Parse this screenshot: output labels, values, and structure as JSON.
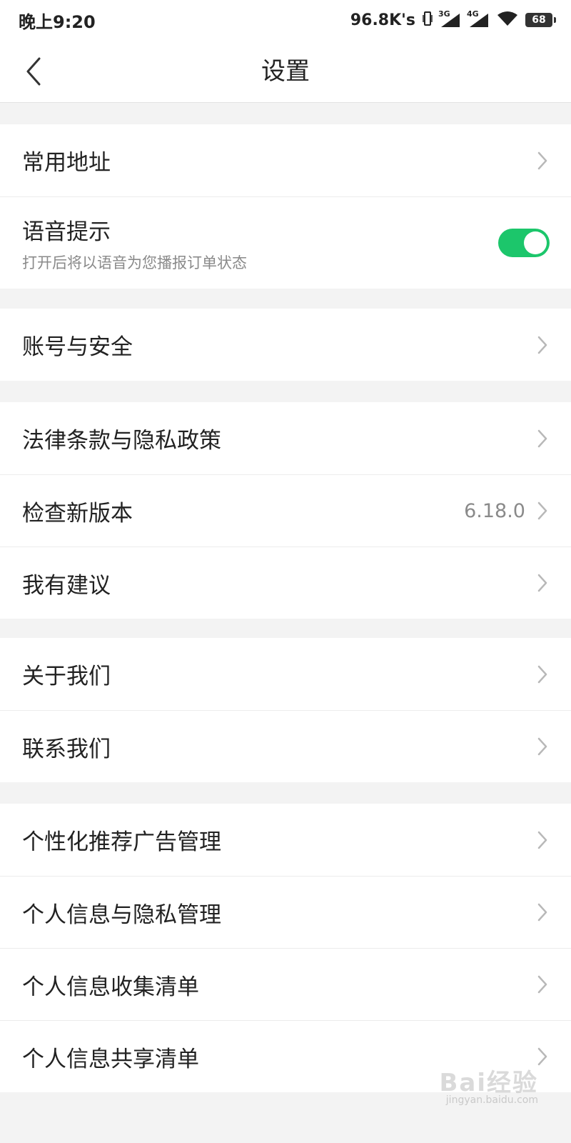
{
  "status_bar": {
    "time": "晚上9:20",
    "speed": "96.8K's",
    "net1": "3G",
    "net2": "4G",
    "battery": "68"
  },
  "nav": {
    "back_icon": "chevron-left-icon",
    "title": "设置"
  },
  "groups": [
    {
      "rows": [
        {
          "label": "常用地址"
        },
        {
          "label": "语音提示",
          "sub": "打开后将以语音为您播报订单状态",
          "toggle": true
        }
      ]
    },
    {
      "rows": [
        {
          "label": "账号与安全"
        }
      ]
    },
    {
      "rows": [
        {
          "label": "法律条款与隐私政策"
        },
        {
          "label": "检查新版本",
          "value": "6.18.0"
        },
        {
          "label": "我有建议"
        }
      ]
    },
    {
      "rows": [
        {
          "label": "关于我们"
        },
        {
          "label": "联系我们"
        }
      ]
    },
    {
      "rows": [
        {
          "label": "个性化推荐广告管理"
        },
        {
          "label": "个人信息与隐私管理"
        },
        {
          "label": "个人信息收集清单"
        },
        {
          "label": "个人信息共享清单"
        }
      ]
    }
  ],
  "watermark": {
    "brand": "Bai经验",
    "url": "jingyan.baidu.com"
  },
  "colors": {
    "accent_toggle": "#1cc66b",
    "background": "#f3f3f3",
    "secondary_text": "#8a8a8a"
  }
}
